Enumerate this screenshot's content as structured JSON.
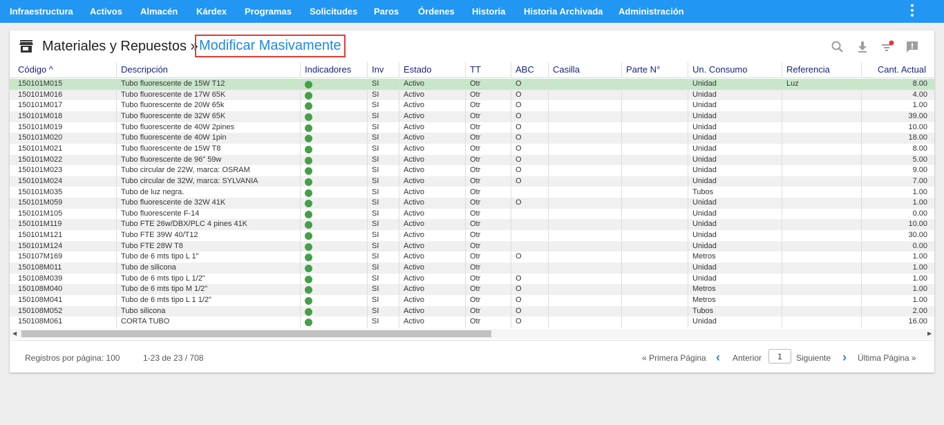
{
  "nav": {
    "items": [
      "Infraestructura",
      "Activos",
      "Almacén",
      "Kárdex",
      "Programas",
      "Solicitudes",
      "Paros",
      "Órdenes",
      "Historia",
      "Historia Archivada",
      "Administración"
    ]
  },
  "header": {
    "title": "Materiales y Repuestos »",
    "link": "Modificar Masivamente",
    "icons": [
      "search-icon",
      "download-icon",
      "filter-icon",
      "feedback-icon"
    ],
    "accent": "#2196f3",
    "highlight_border": "#e53935"
  },
  "table": {
    "columns": [
      "Código ^",
      "Descripción",
      "Indicadores",
      "Inv",
      "Estado",
      "TT",
      "ABC",
      "Casilla",
      "Parte N°",
      "Un. Consumo",
      "Referencia",
      "Cant. Actual"
    ],
    "rows": [
      {
        "codigo": "150101M015",
        "desc": "Tubo fluorescente de 15W T12",
        "ind": "green",
        "inv": "SI",
        "estado": "Activo",
        "tt": "Otr",
        "abc": "O",
        "casilla": "",
        "parte": "",
        "unidad": "Unidad",
        "ref": "Luz",
        "cant": "8.00"
      },
      {
        "codigo": "150101M016",
        "desc": "Tubo fluorescente de 17W 65K",
        "ind": "green",
        "inv": "SI",
        "estado": "Activo",
        "tt": "Otr",
        "abc": "O",
        "casilla": "",
        "parte": "",
        "unidad": "Unidad",
        "ref": "",
        "cant": "4.00"
      },
      {
        "codigo": "150101M017",
        "desc": "Tubo fluorescente de 20W 65k",
        "ind": "green",
        "inv": "SI",
        "estado": "Activo",
        "tt": "Otr",
        "abc": "O",
        "casilla": "",
        "parte": "",
        "unidad": "Unidad",
        "ref": "",
        "cant": "1.00"
      },
      {
        "codigo": "150101M018",
        "desc": "Tubo fluorescente de 32W 65K",
        "ind": "green",
        "inv": "SI",
        "estado": "Activo",
        "tt": "Otr",
        "abc": "O",
        "casilla": "",
        "parte": "",
        "unidad": "Unidad",
        "ref": "",
        "cant": "39.00"
      },
      {
        "codigo": "150101M019",
        "desc": "Tubo fluorescente de 40W 2pines",
        "ind": "green",
        "inv": "SI",
        "estado": "Activo",
        "tt": "Otr",
        "abc": "O",
        "casilla": "",
        "parte": "",
        "unidad": "Unidad",
        "ref": "",
        "cant": "10.00"
      },
      {
        "codigo": "150101M020",
        "desc": "Tubo fluorescente de 40W 1pin",
        "ind": "green",
        "inv": "SI",
        "estado": "Activo",
        "tt": "Otr",
        "abc": "O",
        "casilla": "",
        "parte": "",
        "unidad": "Unidad",
        "ref": "",
        "cant": "18.00"
      },
      {
        "codigo": "150101M021",
        "desc": "Tubo fluorescente de 15W T8",
        "ind": "green",
        "inv": "SI",
        "estado": "Activo",
        "tt": "Otr",
        "abc": "O",
        "casilla": "",
        "parte": "",
        "unidad": "Unidad",
        "ref": "",
        "cant": "8.00"
      },
      {
        "codigo": "150101M022",
        "desc": "Tubo fluorescente de 96\" 59w",
        "ind": "green",
        "inv": "SI",
        "estado": "Activo",
        "tt": "Otr",
        "abc": "O",
        "casilla": "",
        "parte": "",
        "unidad": "Unidad",
        "ref": "",
        "cant": "5.00"
      },
      {
        "codigo": "150101M023",
        "desc": "Tubo circular de 22W, marca: OSRAM",
        "ind": "green",
        "inv": "SI",
        "estado": "Activo",
        "tt": "Otr",
        "abc": "O",
        "casilla": "",
        "parte": "",
        "unidad": "Unidad",
        "ref": "",
        "cant": "9.00"
      },
      {
        "codigo": "150101M024",
        "desc": "Tubo circular de 32W, marca: SYLVANIA",
        "ind": "green",
        "inv": "SI",
        "estado": "Activo",
        "tt": "Otr",
        "abc": "O",
        "casilla": "",
        "parte": "",
        "unidad": "Unidad",
        "ref": "",
        "cant": "7.00"
      },
      {
        "codigo": "150101M035",
        "desc": "Tubo de luz negra.",
        "ind": "green",
        "inv": "SI",
        "estado": "Activo",
        "tt": "Otr",
        "abc": "",
        "casilla": "",
        "parte": "",
        "unidad": "Tubos",
        "ref": "",
        "cant": "1.00"
      },
      {
        "codigo": "150101M059",
        "desc": "Tubo fluorescente de 32W 41K",
        "ind": "green",
        "inv": "SI",
        "estado": "Activo",
        "tt": "Otr",
        "abc": "O",
        "casilla": "",
        "parte": "",
        "unidad": "Unidad",
        "ref": "",
        "cant": "1.00"
      },
      {
        "codigo": "150101M105",
        "desc": "Tubo fluorescente F-14",
        "ind": "green",
        "inv": "SI",
        "estado": "Activo",
        "tt": "Otr",
        "abc": "",
        "casilla": "",
        "parte": "",
        "unidad": "Unidad",
        "ref": "",
        "cant": "0.00"
      },
      {
        "codigo": "150101M119",
        "desc": "Tubo FTE 26w/DBX/PLC 4 pines 41K",
        "ind": "green",
        "inv": "SI",
        "estado": "Activo",
        "tt": "Otr",
        "abc": "",
        "casilla": "",
        "parte": "",
        "unidad": "Unidad",
        "ref": "",
        "cant": "10.00"
      },
      {
        "codigo": "150101M121",
        "desc": "Tubo FTE 39W 40/T12",
        "ind": "green",
        "inv": "SI",
        "estado": "Activo",
        "tt": "Otr",
        "abc": "",
        "casilla": "",
        "parte": "",
        "unidad": "Unidad",
        "ref": "",
        "cant": "30.00"
      },
      {
        "codigo": "150101M124",
        "desc": "Tubo FTE 28W T8",
        "ind": "green",
        "inv": "SI",
        "estado": "Activo",
        "tt": "Otr",
        "abc": "",
        "casilla": "",
        "parte": "",
        "unidad": "Unidad",
        "ref": "",
        "cant": "0.00"
      },
      {
        "codigo": "150107M169",
        "desc": "Tubo de 6 mts tipo L 1\"",
        "ind": "green",
        "inv": "SI",
        "estado": "Activo",
        "tt": "Otr",
        "abc": "O",
        "casilla": "",
        "parte": "",
        "unidad": "Metros",
        "ref": "",
        "cant": "1.00"
      },
      {
        "codigo": "150108M011",
        "desc": "Tubo de silicona",
        "ind": "green",
        "inv": "SI",
        "estado": "Activo",
        "tt": "Otr",
        "abc": "",
        "casilla": "",
        "parte": "",
        "unidad": "Unidad",
        "ref": "",
        "cant": "1.00"
      },
      {
        "codigo": "150108M039",
        "desc": "Tubo de 6 mts tipo L 1/2\"",
        "ind": "green",
        "inv": "SI",
        "estado": "Activo",
        "tt": "Otr",
        "abc": "O",
        "casilla": "",
        "parte": "",
        "unidad": "Unidad",
        "ref": "",
        "cant": "1.00"
      },
      {
        "codigo": "150108M040",
        "desc": "Tubo de 6 mts tipo M 1/2\"",
        "ind": "green",
        "inv": "SI",
        "estado": "Activo",
        "tt": "Otr",
        "abc": "O",
        "casilla": "",
        "parte": "",
        "unidad": "Metros",
        "ref": "",
        "cant": "1.00"
      },
      {
        "codigo": "150108M041",
        "desc": "Tubo de 6 mts tipo L 1 1/2\"",
        "ind": "green",
        "inv": "SI",
        "estado": "Activo",
        "tt": "Otr",
        "abc": "O",
        "casilla": "",
        "parte": "",
        "unidad": "Metros",
        "ref": "",
        "cant": "1.00"
      },
      {
        "codigo": "150108M052",
        "desc": "Tubo silicona",
        "ind": "green",
        "inv": "SI",
        "estado": "Activo",
        "tt": "Otr",
        "abc": "O",
        "casilla": "",
        "parte": "",
        "unidad": "Tubos",
        "ref": "",
        "cant": "2.00"
      },
      {
        "codigo": "150108M061",
        "desc": "CORTA TUBO",
        "ind": "green",
        "inv": "SI",
        "estado": "Activo",
        "tt": "Otr",
        "abc": "O",
        "casilla": "",
        "parte": "",
        "unidad": "Unidad",
        "ref": "",
        "cant": "16.00"
      }
    ],
    "selected_row_color": "#c8e6c9",
    "indicator_color": "#43a047"
  },
  "footer": {
    "per_page": "Registros por página: 100",
    "range": "1-23 de 23 / 708",
    "first": "« Primera Página",
    "prev": "Anterior",
    "page_value": "1",
    "next": "Siguiente",
    "last": "Última Página »"
  }
}
